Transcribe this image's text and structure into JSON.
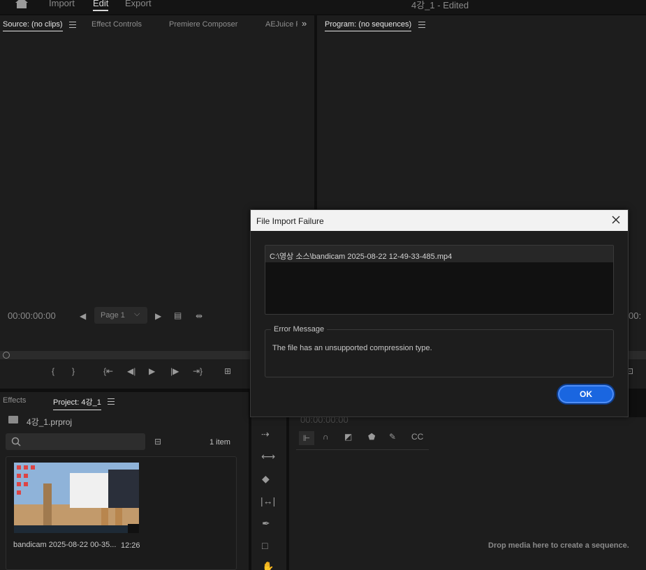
{
  "app": {
    "top_tabs": [
      "Import",
      "Edit",
      "Export"
    ],
    "document_title": "4강_1 - Edited"
  },
  "source_panel": {
    "tabs": [
      "Source: (no clips)",
      "Effect Controls",
      "Premiere Composer",
      "AEJuice P"
    ],
    "timecode": "00:00:00:00",
    "page_select": "Page 1"
  },
  "program_panel": {
    "title": "Program: (no sequences)",
    "timecode_partial": "00:"
  },
  "project_panel": {
    "tabs": [
      "Effects",
      "Project: 4강_1"
    ],
    "project_file": "4강_1.prproj",
    "item_count": "1 item",
    "search_placeholder": "",
    "clip_name": "bandicam 2025-08-22 00-35...",
    "clip_duration": "12:26"
  },
  "timeline_panel": {
    "timecode": "00:00:00:00",
    "drop_message": "Drop media here to create a sequence."
  },
  "dialog": {
    "title": "File Import Failure",
    "file_path": "C:\\영상 소스\\bandicam 2025-08-22 12-49-33-485.mp4",
    "error_legend": "Error Message",
    "error_text": "The file has an unsupported compression type.",
    "ok_label": "OK"
  },
  "colors": {
    "accent_blue": "#1a66e0",
    "panel_bg": "#1d1d1d",
    "app_bg": "#0f0f0f"
  }
}
